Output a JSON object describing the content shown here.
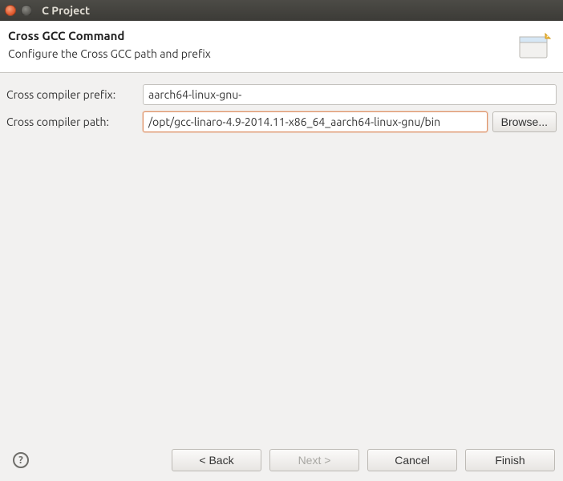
{
  "window": {
    "title": "C Project"
  },
  "header": {
    "title": "Cross GCC Command",
    "subtitle": "Configure the Cross GCC path and prefix"
  },
  "form": {
    "prefix_label": "Cross compiler prefix:",
    "prefix_value": "aarch64-linux-gnu-",
    "path_label": "Cross compiler path:",
    "path_value": "/opt/gcc-linaro-4.9-2014.11-x86_64_aarch64-linux-gnu/bin",
    "browse_label": "Browse..."
  },
  "footer": {
    "help_glyph": "?",
    "back": "< Back",
    "next": "Next >",
    "cancel": "Cancel",
    "finish": "Finish"
  }
}
